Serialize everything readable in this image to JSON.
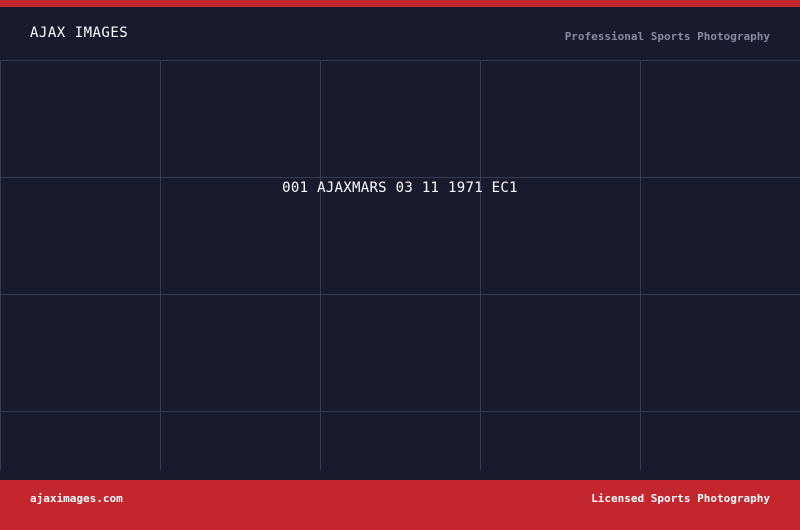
{
  "header": {
    "brand": "AJAX IMAGES",
    "tagline": "Professional Sports Photography"
  },
  "photo": {
    "caption": "001 AJAXMARS 03 11 1971 EC1"
  },
  "footer": {
    "website": "ajaximages.com",
    "tagline": "Licensed Sports Photography"
  },
  "colors": {
    "accent": "#c4262e",
    "background": "#1a1a2e",
    "grid_line": "#363a52",
    "muted_text": "#8a8aa0",
    "text": "#ffffff"
  }
}
